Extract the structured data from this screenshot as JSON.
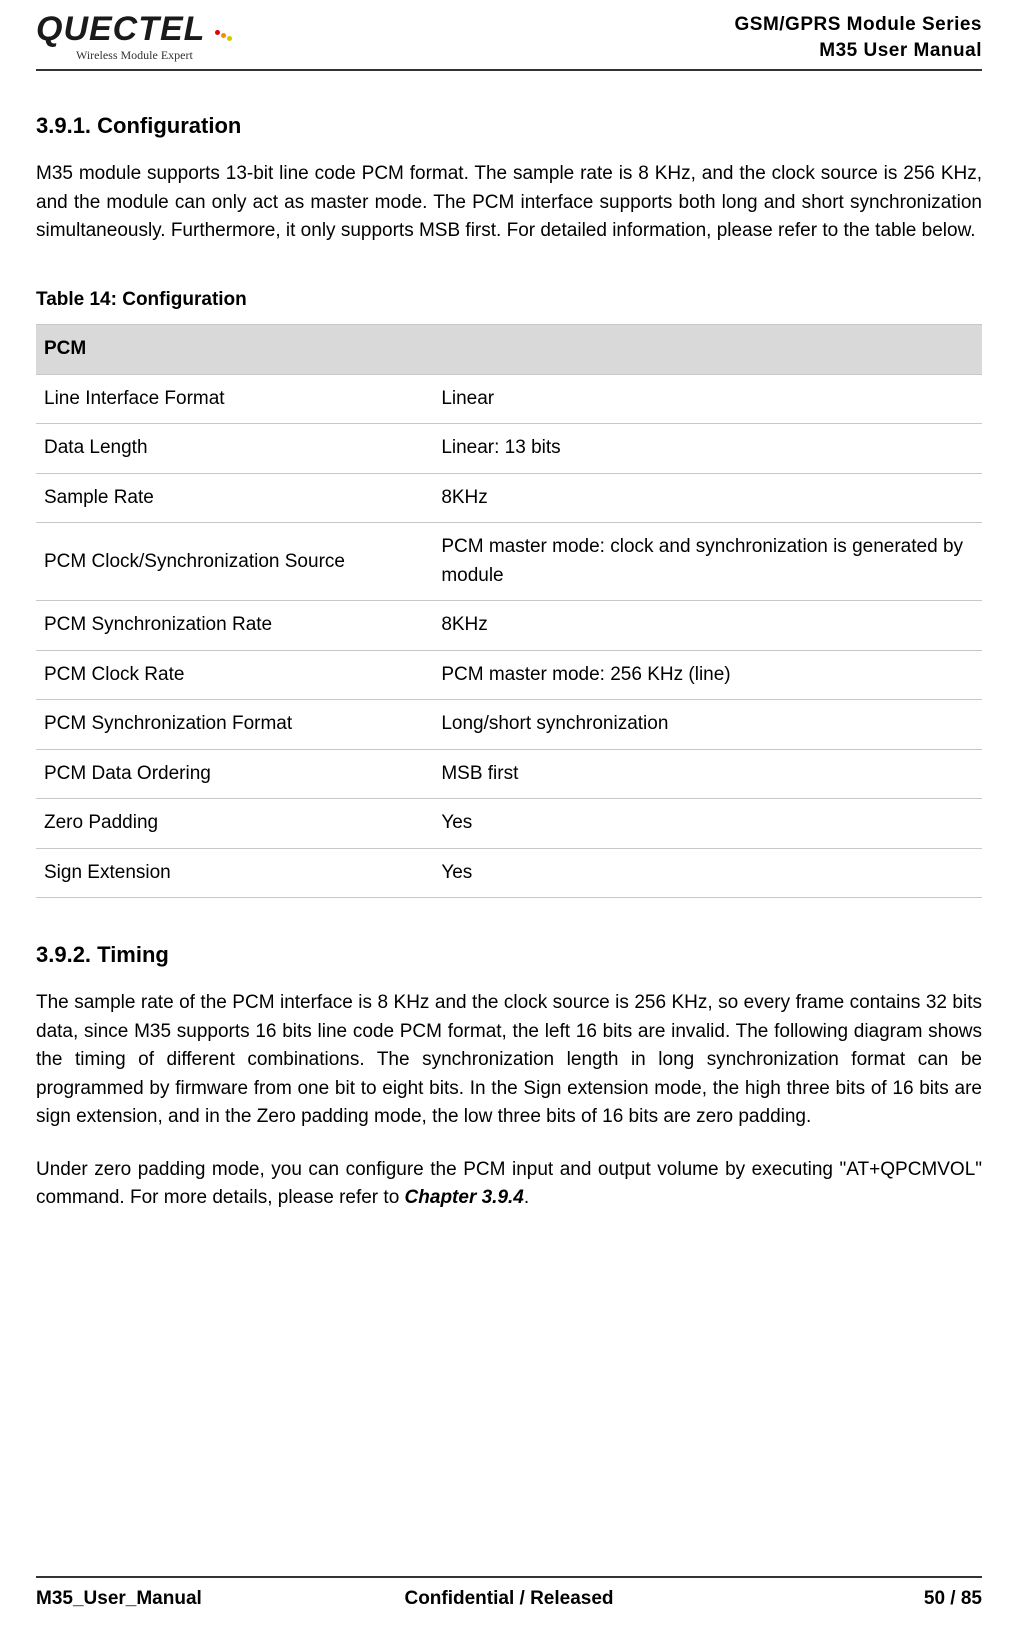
{
  "header": {
    "logo_main": "QUECTEL",
    "logo_sub": "Wireless Module Expert",
    "series": "GSM/GPRS  Module  Series",
    "manual": "M35  User  Manual"
  },
  "s391": {
    "title": "3.9.1.  Configuration",
    "para": "M35 module supports 13-bit line code PCM format. The sample rate is 8 KHz, and the clock source is 256 KHz, and the module can only act as master mode. The PCM interface supports both long and short synchronization simultaneously. Furthermore, it only supports MSB first. For detailed information, please refer to the table below."
  },
  "table": {
    "caption": "Table 14: Configuration",
    "head": "PCM",
    "rows": [
      {
        "k": "Line Interface Format",
        "v": "Linear"
      },
      {
        "k": "Data Length",
        "v": "Linear: 13 bits"
      },
      {
        "k": "Sample Rate",
        "v": "8KHz"
      },
      {
        "k": "PCM Clock/Synchronization Source",
        "v": "PCM master mode: clock and synchronization is generated by module"
      },
      {
        "k": "PCM Synchronization Rate",
        "v": "8KHz"
      },
      {
        "k": "PCM Clock Rate",
        "v": "PCM master mode: 256 KHz (line)"
      },
      {
        "k": "PCM Synchronization Format",
        "v": "Long/short synchronization"
      },
      {
        "k": "PCM Data Ordering",
        "v": "MSB first"
      },
      {
        "k": "Zero Padding",
        "v": "Yes"
      },
      {
        "k": "Sign Extension",
        "v": "Yes"
      }
    ]
  },
  "s392": {
    "title": "3.9.2.  Timing",
    "para1": "The sample rate of the PCM interface is 8 KHz and the clock source is 256 KHz, so every frame contains 32 bits data, since M35 supports 16 bits line code PCM format, the left 16 bits are invalid. The following diagram shows the timing of different combinations. The synchronization length in long synchronization format can be programmed by firmware from one bit to eight bits. In the Sign extension mode, the high three bits of 16 bits are sign extension, and in the Zero padding mode, the low three bits of 16 bits are zero padding.",
    "para2_a": "Under zero padding mode, you can configure the PCM input and output volume by executing \"AT+QPCMVOL\" command. For more details, please refer to ",
    "para2_ref": "Chapter 3.9.4",
    "para2_b": "."
  },
  "footer": {
    "left": "M35_User_Manual",
    "center": "Confidential / Released",
    "right": "50 / 85"
  }
}
